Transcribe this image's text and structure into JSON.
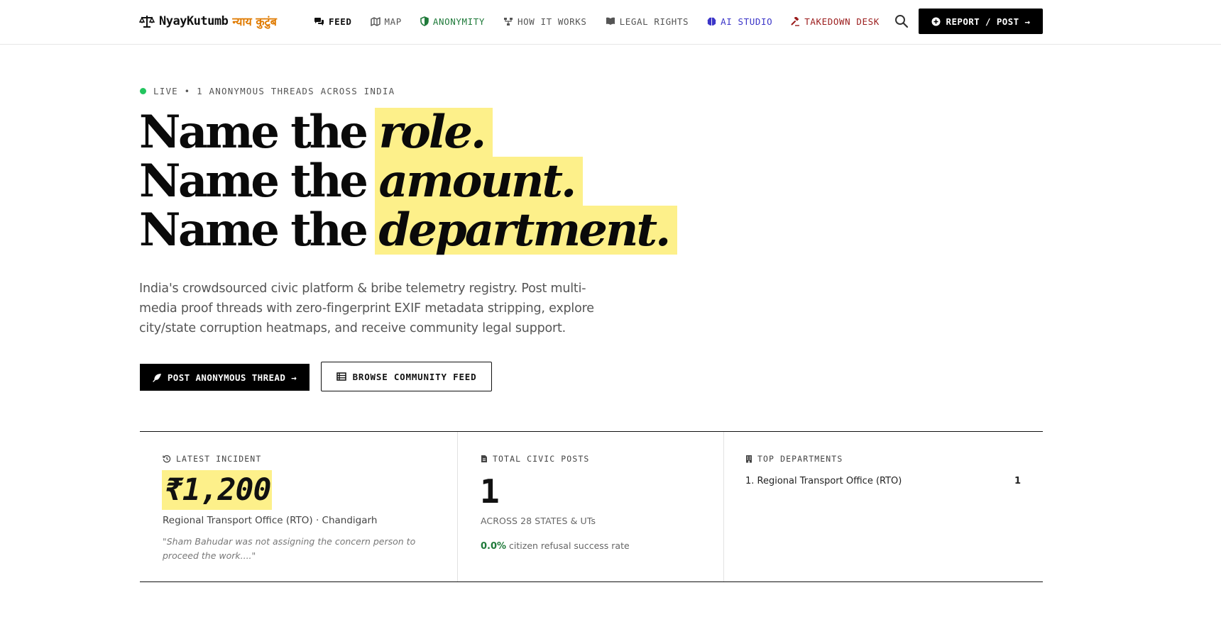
{
  "nav": {
    "brand_name": "NyayKutumb",
    "brand_hindi": "न्याय कुटुंब",
    "links": [
      {
        "label": "FEED",
        "icon": "chat-bubbles-icon"
      },
      {
        "label": "MAP",
        "icon": "map-icon"
      },
      {
        "label": "ANONYMITY",
        "icon": "shield-icon"
      },
      {
        "label": "HOW IT WORKS",
        "icon": "flow-nodes-icon"
      },
      {
        "label": "LEGAL RIGHTS",
        "icon": "book-icon"
      },
      {
        "label": "AI STUDIO",
        "icon": "brain-icon"
      },
      {
        "label": "TAKEDOWN DESK",
        "icon": "gavel-icon"
      }
    ],
    "report_label": "REPORT / POST →"
  },
  "hero": {
    "live_text": "LIVE • 1 ANONYMOUS THREADS ACROSS INDIA",
    "headline": [
      {
        "static": "Name the",
        "highlight": "role."
      },
      {
        "static": "Name the",
        "highlight": "amount."
      },
      {
        "static": "Name the",
        "highlight": "department."
      }
    ],
    "subtitle": "India's crowdsourced civic platform & bribe telemetry registry. Post multi-media proof threads with zero-fingerprint EXIF metadata stripping, explore city/state corruption heatmaps, and receive community legal support.",
    "primary_cta": "POST ANONYMOUS THREAD →",
    "secondary_cta": "BROWSE COMMUNITY FEED"
  },
  "stats": {
    "latest": {
      "label": "LATEST INCIDENT",
      "amount": "₹1,200",
      "location": "Regional Transport Office (RTO) · Chandigarh",
      "quote": "\"Sham Bahudar was not assigning the concern person to proceed the work....\""
    },
    "total": {
      "label": "TOTAL CIVIC POSTS",
      "value": "1",
      "subtitle": "ACROSS 28 STATES & UTs",
      "refusal_value": "0.0%",
      "refusal_text": "citizen refusal success rate"
    },
    "departments": {
      "label": "TOP DEPARTMENTS",
      "items": [
        {
          "name": "1. Regional Transport Office (RTO)",
          "count": "1"
        }
      ]
    }
  },
  "colors": {
    "highlight": "#fdf08a",
    "live_dot": "#22c55e",
    "anonymity": "#1f7a3a",
    "ai_studio": "#3b35c8",
    "takedown": "#9b1c1c",
    "brand_hindi": "#e07b00"
  }
}
